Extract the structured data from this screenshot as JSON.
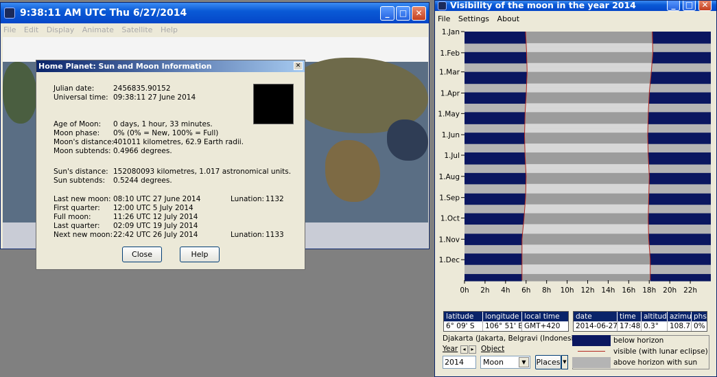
{
  "home_planet": {
    "title": "9:38:11 AM UTC Thu 6/27/2014",
    "menu": [
      "File",
      "Edit",
      "Display",
      "Animate",
      "Satellite",
      "Help"
    ]
  },
  "info_dialog": {
    "title": "Home Planet: Sun and Moon Information",
    "julian_label": "Julian date:",
    "julian_value": "2456835.90152",
    "ut_label": "Universal time:",
    "ut_value": "09:38:11 27 June 2014",
    "age_label": "Age of Moon:",
    "age_value": "0 days, 1 hour, 33 minutes.",
    "phase_label": "Moon phase:",
    "phase_value": "0%   (0% = New, 100% = Full)",
    "mdist_label": "Moon's distance:",
    "mdist_value": "401011 kilometres, 62.9 Earth radii.",
    "msub_label": "Moon subtends:",
    "msub_value": "0.4966 degrees.",
    "sdist_label": "Sun's distance:",
    "sdist_value": "152080093 kilometres, 1.017 astronomical units.",
    "ssub_label": "Sun subtends:",
    "ssub_value": "0.5244 degrees.",
    "lastnew_label": "Last new moon:",
    "lastnew_value": "08:10 UTC 27 June 2014",
    "lastnew_lun_label": "Lunation:",
    "lastnew_lun_value": "1132",
    "fq_label": "First quarter:",
    "fq_value": "12:00 UTC  5 July 2014",
    "full_label": "Full moon:",
    "full_value": "11:26 UTC 12 July 2014",
    "lq_label": "Last quarter:",
    "lq_value": "02:09 UTC 19 July 2014",
    "nextnew_label": "Next new moon:",
    "nextnew_value": "22:42 UTC 26 July 2014",
    "nextnew_lun_label": "Lunation:",
    "nextnew_lun_value": "1133",
    "close_label": "Close",
    "help_label": "Help"
  },
  "visibility": {
    "title": "Visibility of the moon in the year 2014",
    "menu": [
      "File",
      "Settings",
      "About"
    ],
    "location_table": {
      "headers": [
        "latitude",
        "longitude",
        "local time"
      ],
      "values": [
        "6° 09' S",
        "106° 51' E",
        "GMT+420"
      ]
    },
    "position_table": {
      "headers": [
        "date",
        "time",
        "altitude",
        "azimut",
        "phs"
      ],
      "values": [
        "2014-06-27",
        "17:48",
        "0.3°",
        "108.7°",
        "0%"
      ]
    },
    "place": "Djakarta (Jakarta, Belgravi (Indonesia)",
    "year_label": "Year",
    "object_label": "Object",
    "year_value": "2014",
    "object_value": "Moon",
    "places_label": "Places",
    "legend": [
      {
        "label": "below horizon",
        "color": "#0a1760"
      },
      {
        "label": "visible (with lunar eclipse)",
        "color": "#b3261e"
      },
      {
        "label": "above horizon with sun",
        "color": "#b4b4b4"
      }
    ]
  },
  "chart_data": {
    "type": "heatmap",
    "title": "",
    "y_tick_labels": [
      "1.Jan",
      "1.Feb",
      "1.Mar",
      "1.Apr",
      "1.May",
      "1.Jun",
      "1.Jul",
      "1.Aug",
      "1.Sep",
      "1.Oct",
      "1.Nov",
      "1.Dec"
    ],
    "x_tick_labels": [
      "0h",
      "2h",
      "4h",
      "6h",
      "8h",
      "10h",
      "12h",
      "14h",
      "16h",
      "18h",
      "20h",
      "22h"
    ],
    "x_range_hours": [
      0,
      24
    ],
    "y_range_days": [
      1,
      365
    ],
    "sunrise_hours": [
      5.95,
      6.05,
      6.1,
      6.02,
      5.9,
      5.85,
      5.9,
      6.0,
      5.95,
      5.8,
      5.6,
      5.6
    ],
    "sunset_hours": [
      18.3,
      18.35,
      18.2,
      18.0,
      17.9,
      17.85,
      17.9,
      18.0,
      17.95,
      17.9,
      17.95,
      18.1
    ],
    "colors": {
      "below": "#0a1760",
      "above": "#b4b4b4",
      "above_dark": "#9c9c9c",
      "bright": "#d7d7d7",
      "line": "#b3261e"
    }
  }
}
